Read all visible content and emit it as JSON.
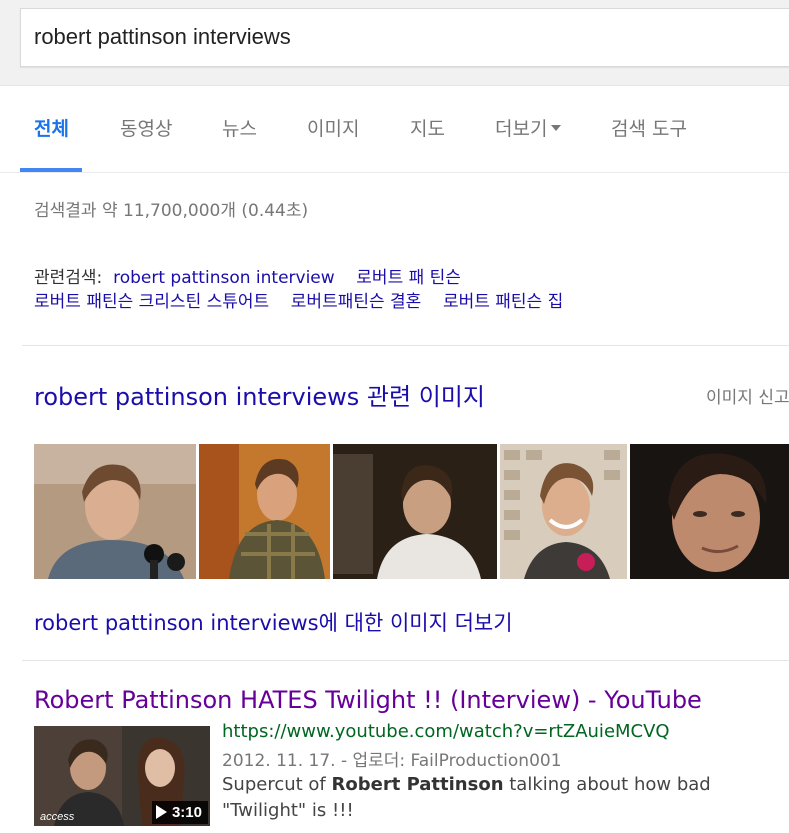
{
  "search": {
    "query": "robert pattinson interviews"
  },
  "tabs": [
    {
      "label": "전체",
      "active": true
    },
    {
      "label": "동영상"
    },
    {
      "label": "뉴스"
    },
    {
      "label": "이미지"
    },
    {
      "label": "지도"
    },
    {
      "label": "더보기"
    },
    {
      "label": "검색 도구"
    }
  ],
  "stats": "검색결과 약 11,700,000개 (0.44초)",
  "related": {
    "label": "관련검색:",
    "links": [
      "robert pattinson interview",
      "로버트 패 틴슨",
      "로버트 패틴슨 크리스틴 스튜어트",
      "로버트패틴슨 결혼",
      "로버트 패틴슨 집"
    ]
  },
  "images": {
    "heading": "robert pattinson interviews 관련 이미지",
    "report": "이미지 신고",
    "more": "robert pattinson interviews에 대한 이미지 더보기",
    "thumbnails": [
      {
        "icon": "photo-man-microphone",
        "bg": "#b59a82"
      },
      {
        "icon": "photo-man-plaid-shirt",
        "bg": "#c4782d"
      },
      {
        "icon": "photo-man-white-tshirt",
        "bg": "#2b2016"
      },
      {
        "icon": "photo-man-smiling-comiccon",
        "bg": "#d8cdbd"
      },
      {
        "icon": "photo-man-closeup",
        "bg": "#171412"
      }
    ]
  },
  "result": {
    "title": "Robert Pattinson HATES Twilight !! (Interview) - YouTube",
    "url": "https://www.youtube.com/watch?v=rtZAuieMCVQ",
    "meta": "2012. 11. 17. - 업로더: FailProduction001",
    "snippet_pre": "Supercut of ",
    "snippet_bold": "Robert Pattinson",
    "snippet_post": " talking about how bad \"Twilight\" is !!!",
    "duration": "3:10",
    "thumb_logo": "access"
  },
  "colors": {
    "link": "#1a0dab",
    "visited": "#660099",
    "url": "#006621",
    "accent": "#4285f4"
  }
}
